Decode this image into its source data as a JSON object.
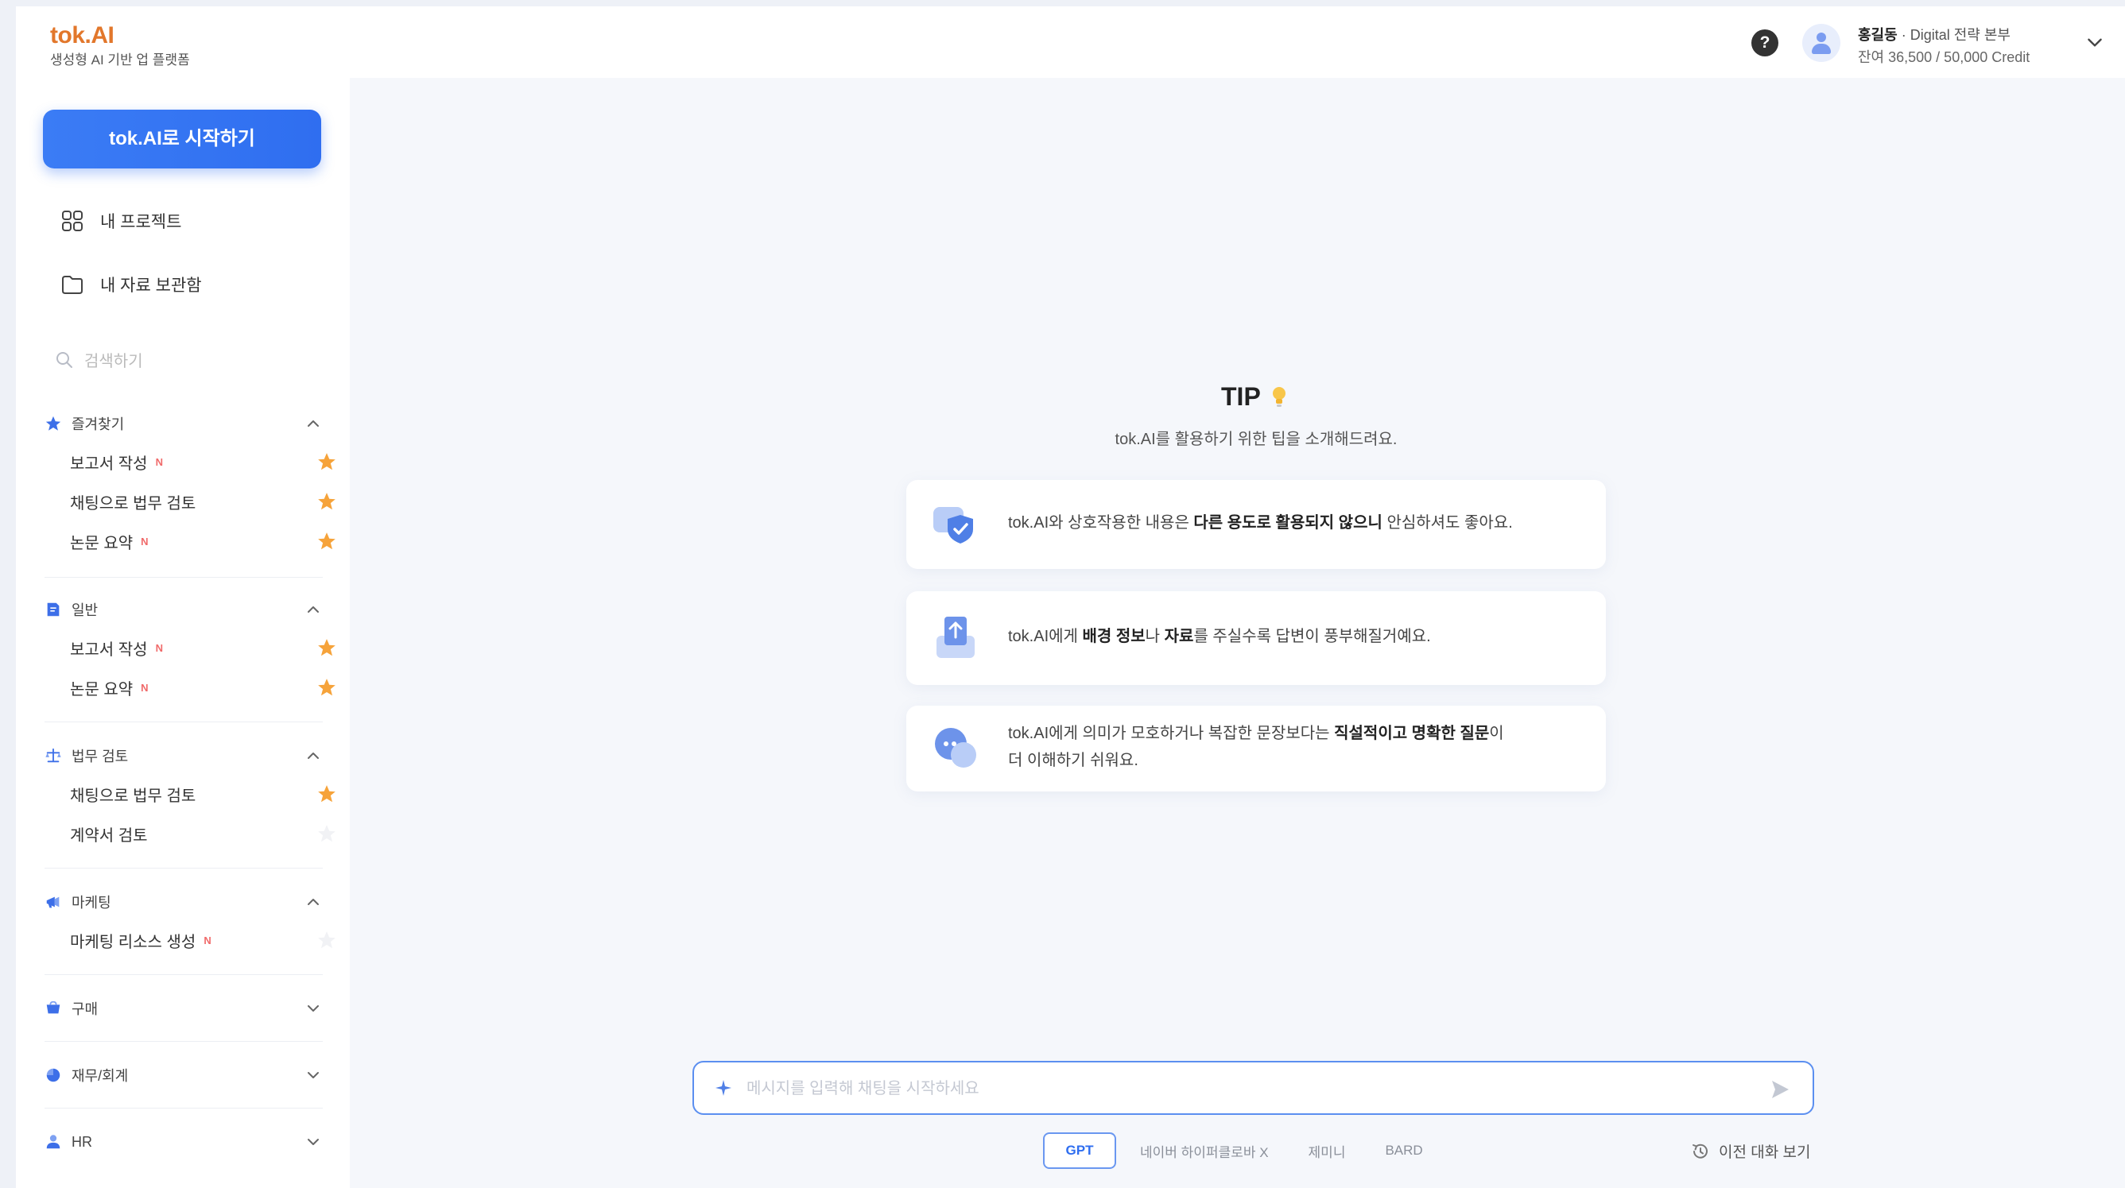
{
  "header": {
    "logo_title": "tok.AI",
    "logo_subtitle": "생성형 AI 기반 업 플랫폼",
    "help_label": "?",
    "user_name": "홍길동",
    "user_department": "Digital 전략 본부",
    "credit_text": "잔여 36,500 / 50,000 Credit"
  },
  "sidebar": {
    "start_button": "tok.AI로 시작하기",
    "links": [
      {
        "label": "내 프로젝트",
        "icon": "grid-icon"
      },
      {
        "label": "내 자료 보관함",
        "icon": "folder-icon"
      }
    ],
    "search_placeholder": "검색하기",
    "sections": [
      {
        "label": "즐겨찾기",
        "icon": "star-icon",
        "expanded": true,
        "items": [
          {
            "label": "보고서 작성",
            "new": "N",
            "starred": true
          },
          {
            "label": "채팅으로 법무 검토",
            "new": "",
            "starred": true
          },
          {
            "label": "논문 요약",
            "new": "N",
            "starred": true
          }
        ]
      },
      {
        "label": "일반",
        "icon": "doc-icon",
        "expanded": true,
        "items": [
          {
            "label": "보고서 작성",
            "new": "N",
            "starred": true
          },
          {
            "label": "논문 요약",
            "new": "N",
            "starred": true
          }
        ]
      },
      {
        "label": "법무 검토",
        "icon": "scale-icon",
        "expanded": true,
        "items": [
          {
            "label": "채팅으로 법무 검토",
            "new": "",
            "starred": true
          },
          {
            "label": "계약서 검토",
            "new": "",
            "starred": false
          }
        ]
      },
      {
        "label": "마케팅",
        "icon": "megaphone-icon",
        "expanded": true,
        "items": [
          {
            "label": "마케팅 리소스 생성",
            "new": "N",
            "starred": false
          }
        ]
      },
      {
        "label": "구매",
        "icon": "cart-icon",
        "expanded": false,
        "items": []
      },
      {
        "label": "재무/회계",
        "icon": "chart-icon",
        "expanded": false,
        "items": []
      },
      {
        "label": "HR",
        "icon": "person-icon",
        "expanded": false,
        "items": []
      }
    ]
  },
  "main": {
    "tip_title": "TIP",
    "tip_subtitle": "tok.AI를 활용하기 위한 팁을 소개해드려요.",
    "tips": [
      {
        "pre": "tok.AI와 상호작용한 내용은 ",
        "bold": "다른 용도로 활용되지 않으니",
        "post": " 안심하셔도 좋아요.",
        "line2": "",
        "icon": "shield-icon"
      },
      {
        "pre": "tok.AI에게 ",
        "bold": "배경 정보",
        "mid": "나 ",
        "bold2": "자료",
        "post": "를 주실수록 답변이 풍부해질거예요.",
        "line2": "",
        "icon": "document-upload-icon"
      },
      {
        "pre": "tok.AI에게 의미가 모호하거나 복잡한 문장보다는 ",
        "bold": "직설적이고 명확한 질문",
        "post": "이",
        "line2": "더 이해하기 쉬워요.",
        "icon": "chat-bubble-icon"
      }
    ],
    "input_placeholder": "메시지를 입력해 채팅을 시작하세요",
    "model_tabs": [
      "GPT",
      "네이버 하이퍼클로바 X",
      "제미니",
      "BARD"
    ],
    "active_model": "GPT",
    "history_link": "이전 대화 보기"
  },
  "colors": {
    "brand_orange": "#e2772b",
    "primary_blue": "#2f6ef0",
    "star_orange": "#f6a33a",
    "new_badge": "#f06a6a"
  }
}
